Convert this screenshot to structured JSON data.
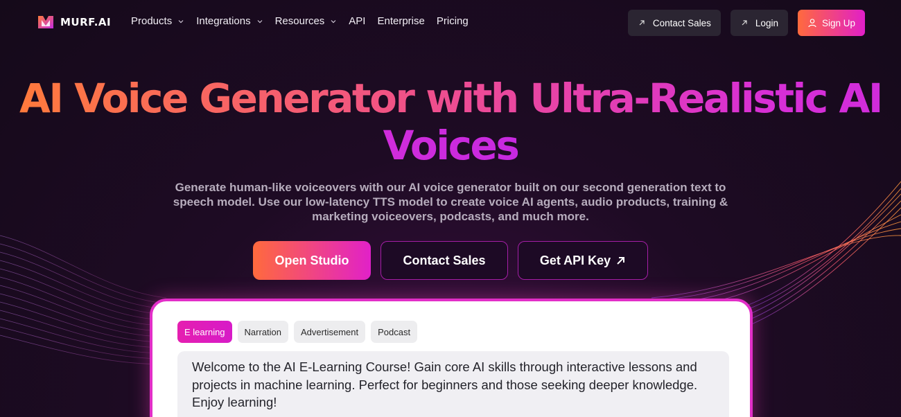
{
  "brand": {
    "name": "MURF.AI"
  },
  "nav": {
    "links": [
      {
        "label": "Products",
        "has_menu": true
      },
      {
        "label": "Integrations",
        "has_menu": true
      },
      {
        "label": "Resources",
        "has_menu": true
      },
      {
        "label": "API",
        "has_menu": false
      },
      {
        "label": "Enterprise",
        "has_menu": false
      },
      {
        "label": "Pricing",
        "has_menu": false
      }
    ],
    "contact_sales": "Contact Sales",
    "login": "Login",
    "signup": "Sign Up"
  },
  "hero": {
    "title": "AI Voice Generator with Ultra-Realistic AI Voices",
    "subtitle": "Generate human-like voiceovers with our AI voice generator built on our second generation text to speech model. Use our low-latency TTS model to create voice AI agents, audio products, training & marketing voiceovers, podcasts, and much more.",
    "cta_primary": "Open Studio",
    "cta_contact": "Contact Sales",
    "cta_api": "Get API Key"
  },
  "demo": {
    "tabs": [
      {
        "label": "E learning",
        "active": true
      },
      {
        "label": "Narration",
        "active": false
      },
      {
        "label": "Advertisement",
        "active": false
      },
      {
        "label": "Podcast",
        "active": false
      }
    ],
    "text": "Welcome to the AI E-Learning Course! Gain core AI skills through interactive lessons and projects in machine learning. Perfect for beginners and those seeking deeper knowledge. Enjoy learning!"
  },
  "colors": {
    "background": "#150a1a",
    "accent_orange": "#ff6a3d",
    "accent_magenta": "#e11fc8",
    "nav_button": "#2b2532"
  },
  "icons": [
    "murf-logo-icon",
    "chevron-down-icon",
    "arrow-up-right-icon",
    "user-icon"
  ]
}
